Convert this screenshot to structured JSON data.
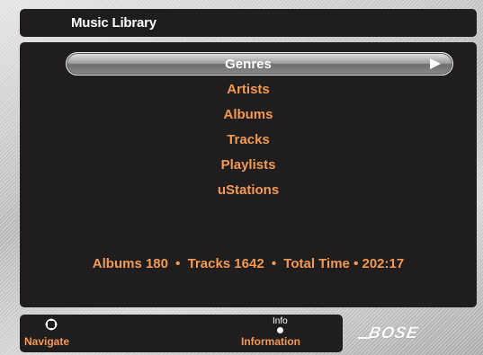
{
  "header": {
    "title": "Music Library"
  },
  "menu": {
    "items": [
      {
        "label": "Genres",
        "selected": true
      },
      {
        "label": "Artists",
        "selected": false
      },
      {
        "label": "Albums",
        "selected": false
      },
      {
        "label": "Tracks",
        "selected": false
      },
      {
        "label": "Playlists",
        "selected": false
      },
      {
        "label": "uStations",
        "selected": false
      }
    ]
  },
  "summary": {
    "albums": "Albums 180",
    "tracks": "Tracks 1642",
    "total_time": "Total Time • 202:17",
    "separator": "•"
  },
  "footer": {
    "navigate_label": "Navigate",
    "navigate_icon": "dpad-icon",
    "info_small": "Info",
    "info_label": "Information"
  },
  "brand": {
    "logo": "BOSE"
  },
  "colors": {
    "accent": "#f29a54",
    "panel": "#1f1d1d",
    "text_selected": "#ffffff"
  }
}
